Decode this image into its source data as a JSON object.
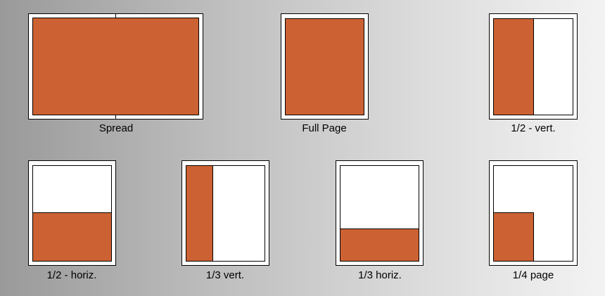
{
  "colors": {
    "ad_fill": "#cc6233",
    "page": "#ffffff",
    "outline": "#000000"
  },
  "layouts": [
    {
      "id": "spread",
      "label": "Spread"
    },
    {
      "id": "full-page",
      "label": "Full Page"
    },
    {
      "id": "half-vert",
      "label": "1/2 - vert."
    },
    {
      "id": "half-horiz",
      "label": "1/2 - horiz."
    },
    {
      "id": "third-vert",
      "label": "1/3 vert."
    },
    {
      "id": "third-horiz",
      "label": "1/3 horiz."
    },
    {
      "id": "quarter-page",
      "label": "1/4 page"
    }
  ]
}
